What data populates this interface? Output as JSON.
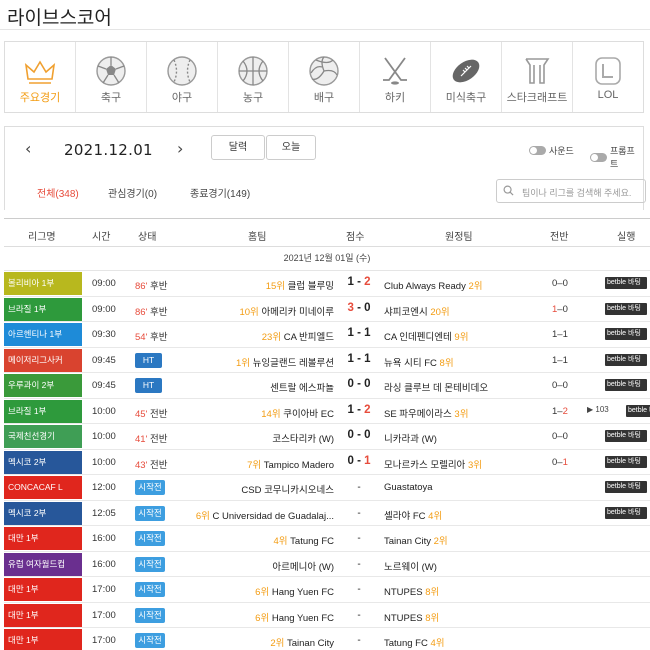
{
  "page": {
    "title": "라이브스코어"
  },
  "sports": [
    {
      "label": "주요경기",
      "icon": "crown-icon",
      "active": true
    },
    {
      "label": "축구",
      "icon": "soccer-ball-icon",
      "active": false
    },
    {
      "label": "야구",
      "icon": "baseball-icon",
      "active": false
    },
    {
      "label": "농구",
      "icon": "basketball-icon",
      "active": false
    },
    {
      "label": "배구",
      "icon": "volleyball-icon",
      "active": false
    },
    {
      "label": "하키",
      "icon": "hockey-sticks-icon",
      "active": false
    },
    {
      "label": "미식축구",
      "icon": "football-icon",
      "active": false
    },
    {
      "label": "스타크래프트",
      "icon": "starcraft-icon",
      "active": false
    },
    {
      "label": "LOL",
      "icon": "lol-icon",
      "active": false
    }
  ],
  "datebar": {
    "prev": "‹",
    "date": "2021.12.01",
    "next": "›",
    "calendar_label": "달력",
    "today_label": "오늘",
    "sound_label": "사운드",
    "push_label": "프롬프트"
  },
  "filters": {
    "all": "전체(348)",
    "favorites": "관심경기(0)",
    "finished": "종료경기(149)"
  },
  "search": {
    "placeholder": "팀이나 리그를 검색해 주세요."
  },
  "table": {
    "headers": {
      "league": "리그명",
      "time": "시간",
      "status": "상태",
      "home": "홈팀",
      "score": "점수",
      "away": "원정팀",
      "halftime": "전반",
      "live": "실행"
    },
    "day_label": "2021년 12월 01일 (수)",
    "bet_label": "betble 바팅",
    "rows": [
      {
        "league": "볼리비아 1부",
        "league_color": "#b8b81e",
        "time": "09:00",
        "status_min": "86'",
        "status_text": "후반",
        "home_rank": "15위",
        "home": "클럽 블루밍",
        "score_home": "1",
        "score_away": "2",
        "hl": "away",
        "away": "Club Always Ready",
        "away_rank": "2위",
        "ht_home": "0",
        "ht_away": "0",
        "ht_hl": "",
        "bet": true
      },
      {
        "league": "브라질 1부",
        "league_color": "#2e9a3c",
        "time": "09:00",
        "status_min": "86'",
        "status_text": "후반",
        "home_rank": "10위",
        "home": "아메리카 미네이루",
        "score_home": "3",
        "score_away": "0",
        "hl": "home",
        "away": "샤피코엔시",
        "away_rank": "20위",
        "ht_home": "1",
        "ht_away": "0",
        "ht_hl": "home",
        "bet": true
      },
      {
        "league": "아르헨티나 1부",
        "league_color": "#1e8bd8",
        "time": "09:30",
        "status_min": "54'",
        "status_text": "후반",
        "home_rank": "23위",
        "home": "CA 반피엘드",
        "score_home": "1",
        "score_away": "1",
        "hl": "",
        "away": "CA 인데펜디엔테",
        "away_rank": "9위",
        "ht_home": "1",
        "ht_away": "1",
        "ht_hl": "",
        "bet": true
      },
      {
        "league": "메이저리그사커",
        "league_color": "#d9432f",
        "time": "09:45",
        "badge": "HT",
        "home_rank": "1위",
        "home": "뉴잉글랜드 레볼루션",
        "score_home": "1",
        "score_away": "1",
        "hl": "",
        "away": "뉴욕 시티 FC",
        "away_rank": "8위",
        "ht_home": "1",
        "ht_away": "1",
        "ht_hl": "",
        "bet": true
      },
      {
        "league": "우루과이 2부",
        "league_color": "#3a9a3a",
        "time": "09:45",
        "badge": "HT",
        "home_rank": "",
        "home": "센트랄 에스파뇰",
        "score_home": "0",
        "score_away": "0",
        "hl": "",
        "away": "라싱 클루브 데 몬테비데오",
        "away_rank": "",
        "ht_home": "0",
        "ht_away": "0",
        "ht_hl": "",
        "bet": true
      },
      {
        "league": "브라질 1부",
        "league_color": "#2e9a3c",
        "time": "10:00",
        "status_min": "45'",
        "status_text": "전반",
        "home_rank": "14위",
        "home": "쿠이아바 EC",
        "score_home": "1",
        "score_away": "2",
        "hl": "away",
        "away": "SE 파우메이라스",
        "away_rank": "3위",
        "ht_home": "1",
        "ht_away": "2",
        "ht_hl": "away",
        "bet": true,
        "cam": "103"
      },
      {
        "league": "국제친선경기",
        "league_color": "#3f9e55",
        "time": "10:00",
        "status_min": "41'",
        "status_text": "전반",
        "home_rank": "",
        "home": "코스타리카 (W)",
        "score_home": "0",
        "score_away": "0",
        "hl": "",
        "away": "니카라과 (W)",
        "away_rank": "",
        "ht_home": "0",
        "ht_away": "0",
        "ht_hl": "",
        "bet": true
      },
      {
        "league": "멕시코 2부",
        "league_color": "#27579a",
        "time": "10:00",
        "status_min": "43'",
        "status_text": "전반",
        "home_rank": "7위",
        "home": "Tampico Madero",
        "score_home": "0",
        "score_away": "1",
        "hl": "away",
        "away": "모나르카스 모렐리아",
        "away_rank": "3위",
        "ht_home": "0",
        "ht_away": "1",
        "ht_hl": "away",
        "bet": true
      },
      {
        "league": "CONCACAF L",
        "league_color": "#e0261d",
        "time": "12:00",
        "badge": "시작전",
        "home_rank": "",
        "home": "CSD 코무니카시오네스",
        "score": "-",
        "away": "Guastatoya",
        "away_rank": "",
        "bet": true
      },
      {
        "league": "멕시코 2부",
        "league_color": "#27579a",
        "time": "12:05",
        "badge": "시작전",
        "home_rank": "6위",
        "home": "C Universidad de Guadalaj...",
        "score": "-",
        "away": "셀라야 FC",
        "away_rank": "4위",
        "bet": true
      },
      {
        "league": "대만 1부",
        "league_color": "#e0261d",
        "time": "16:00",
        "badge": "시작전",
        "home_rank": "4위",
        "home": "Tatung FC",
        "score": "-",
        "away": "Tainan City",
        "away_rank": "2위",
        "bet": false
      },
      {
        "league": "유럽 여자월드컵",
        "league_color": "#6a2f8f",
        "time": "16:00",
        "badge": "시작전",
        "home_rank": "",
        "home": "아르메니아 (W)",
        "score": "-",
        "away": "노르웨이 (W)",
        "away_rank": "",
        "bet": false
      },
      {
        "league": "대만 1부",
        "league_color": "#e0261d",
        "time": "17:00",
        "badge": "시작전",
        "home_rank": "6위",
        "home": "Hang Yuen FC",
        "score": "-",
        "away": "NTUPES",
        "away_rank": "8위",
        "bet": false
      },
      {
        "league": "대만 1부",
        "league_color": "#e0261d",
        "time": "17:00",
        "badge": "시작전",
        "home_rank": "6위",
        "home": "Hang Yuen FC",
        "score": "-",
        "away": "NTUPES",
        "away_rank": "8위",
        "bet": false
      },
      {
        "league": "대만 1부",
        "league_color": "#e0261d",
        "time": "17:00",
        "badge": "시작전",
        "home_rank": "2위",
        "home": "Tainan City",
        "score": "-",
        "away": "Tatung FC",
        "away_rank": "4위",
        "bet": false
      }
    ]
  }
}
